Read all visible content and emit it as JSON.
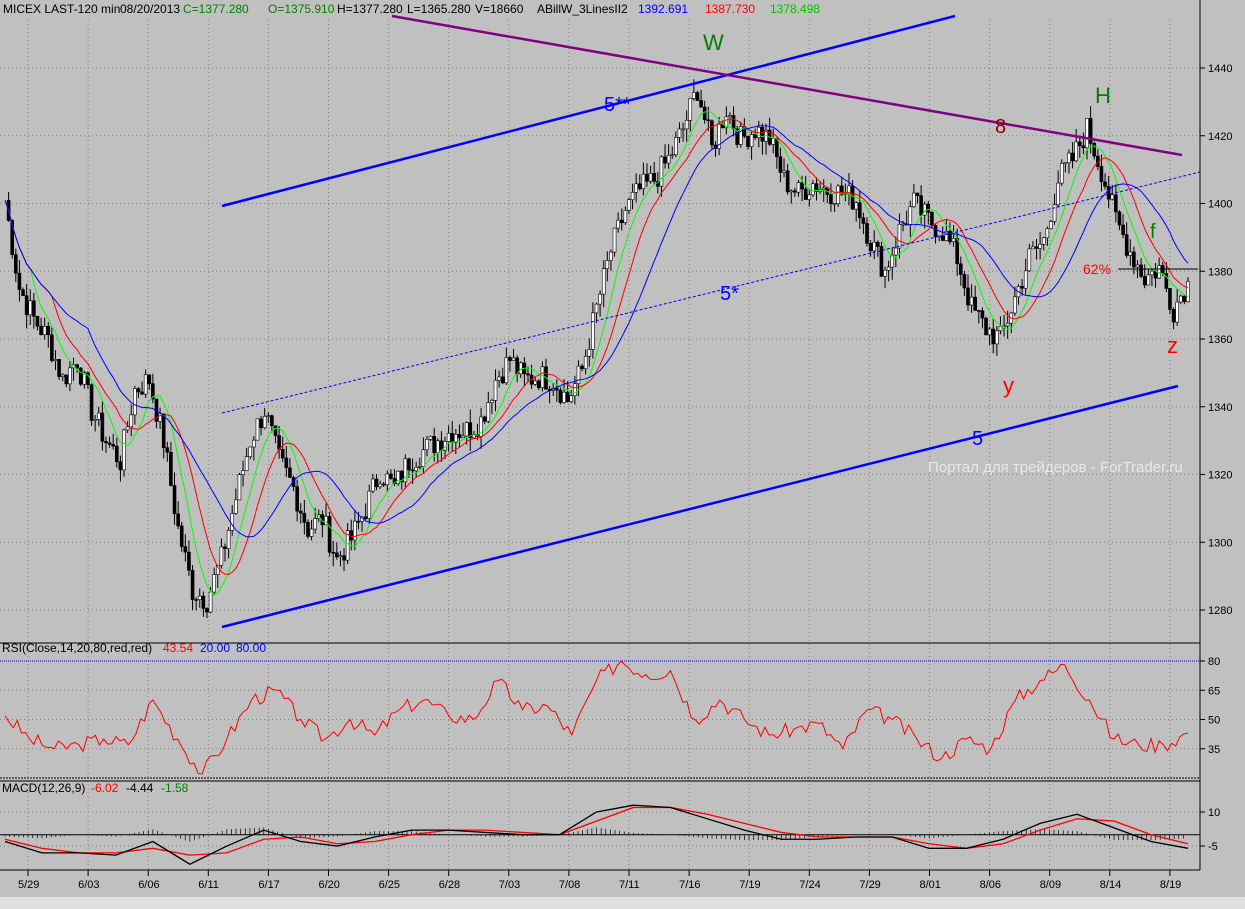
{
  "header": {
    "symbol": "MICEX LAST-120 min",
    "date": "08/20/2013",
    "close": "C=1377.280",
    "open": "O=1375.910",
    "high": "H=1377.280",
    "low": "L=1365.280",
    "volume": "V=18660",
    "indicator": "ABillW_3LinesII2",
    "ind_blue": "1392.691",
    "ind_red": "1387.730",
    "ind_green": "1378.498"
  },
  "watermark": "Портал для трейдеров - ForTrader.ru",
  "annotations": {
    "w": "W",
    "h": "H",
    "eight": "8",
    "five2": "5**",
    "five1": "5*",
    "five": "5",
    "y": "y",
    "z": "z",
    "f": "f",
    "fib": "62%"
  },
  "colors": {
    "background": "#c0c0c0",
    "up": "#000000",
    "ma_fast": "#00ff00",
    "ma_mid": "#ff0000",
    "ma_slow": "#0000ff",
    "rsi": "#ff0000",
    "macd": "#000000",
    "signal": "#ff0000",
    "trend": "#0000ff",
    "fan": "#800080"
  },
  "chart_data": [
    {
      "type": "candlestick",
      "title": "MICEX LAST-120 min",
      "ylim": [
        1270,
        1458
      ],
      "yticks": [
        1280,
        1300,
        1320,
        1340,
        1360,
        1380,
        1400,
        1420,
        1440
      ],
      "xticks": [
        "5/29",
        "6/03",
        "6/06",
        "6/11",
        "6/17",
        "6/20",
        "6/25",
        "6/28",
        "7/03",
        "7/08",
        "7/11",
        "7/16",
        "7/19",
        "7/24",
        "7/29",
        "8/01",
        "8/06",
        "8/09",
        "8/14",
        "8/19"
      ],
      "closes": [
        1401,
        1375,
        1366,
        1360,
        1348,
        1354,
        1339,
        1330,
        1324,
        1345,
        1348,
        1330,
        1304,
        1286,
        1283,
        1295,
        1313,
        1330,
        1339,
        1324,
        1316,
        1304,
        1307,
        1295,
        1301,
        1310,
        1321,
        1316,
        1324,
        1327,
        1330,
        1333,
        1333,
        1336,
        1348,
        1354,
        1348,
        1349,
        1348,
        1342,
        1351,
        1369,
        1386,
        1398,
        1404,
        1407,
        1413,
        1422,
        1434,
        1416,
        1428,
        1419,
        1422,
        1419,
        1407,
        1403,
        1406,
        1404,
        1403,
        1401,
        1389,
        1380,
        1392,
        1400,
        1395,
        1392,
        1384,
        1369,
        1363,
        1360,
        1372,
        1384,
        1389,
        1407,
        1413,
        1422,
        1410,
        1395,
        1386,
        1378,
        1381,
        1369,
        1377
      ]
    },
    {
      "type": "line",
      "title": "RSI(Close,14,20,80,red,red)",
      "last": "43.54",
      "low_level": "20.00",
      "high_level": "80.00",
      "ylim": [
        17,
        83
      ],
      "yticks": [
        80,
        65,
        50,
        35
      ],
      "values": [
        52,
        40,
        35,
        37,
        40,
        37,
        60,
        40,
        22,
        40,
        60,
        65,
        50,
        40,
        50,
        42,
        55,
        60,
        52,
        50,
        70,
        55,
        57,
        42,
        70,
        80,
        73,
        75,
        50,
        60,
        50,
        42,
        45,
        48,
        35,
        55,
        50,
        40,
        30,
        40,
        35,
        60,
        70,
        78,
        60,
        40,
        37,
        37,
        43
      ]
    },
    {
      "type": "line",
      "title": "MACD(12,26,9)",
      "macd_last": "-6.02",
      "signal_last": "-4.44",
      "hist_last": "-1.58",
      "ylim": [
        -10,
        17
      ],
      "yticks": [
        10,
        -5
      ],
      "macd": [
        -3,
        -8,
        -8,
        -9,
        -3,
        -13,
        -5,
        2,
        -3,
        -5,
        -1,
        2,
        2,
        1,
        0,
        0,
        10,
        13,
        12,
        7,
        2,
        -2,
        -2,
        -1,
        -1,
        -6,
        -6,
        -2,
        5,
        9,
        3,
        -3,
        -6
      ],
      "signal": [
        -2,
        -6,
        -8,
        -8,
        -6,
        -9,
        -8,
        -2,
        -1,
        -4,
        -3,
        0,
        2,
        2,
        1,
        0,
        6,
        12,
        12,
        9,
        5,
        1,
        -1,
        -1,
        -1,
        -4,
        -6,
        -4,
        2,
        7,
        6,
        0,
        -4
      ]
    }
  ]
}
